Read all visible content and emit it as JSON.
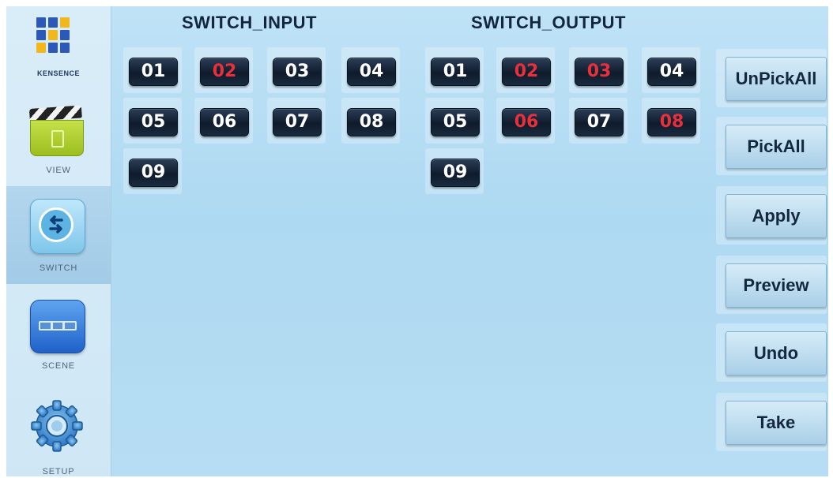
{
  "colors": {
    "selected_channel_text": "#e8303a",
    "channel_text": "#ffffff",
    "screen_background": "#aed9f2",
    "active_nav_background": "#a2cbe7"
  },
  "sidebar": {
    "logo": {
      "text": "KENSENCE",
      "icon": "kensence-logo"
    },
    "items": [
      {
        "label": "VIEW",
        "icon": "clapperboard-icon",
        "active": false
      },
      {
        "label": "SWITCH",
        "icon": "switch-arrows-icon",
        "active": true
      },
      {
        "label": "SCENE",
        "icon": "scene-icon",
        "active": false
      },
      {
        "label": "SETUP",
        "icon": "gear-icon",
        "active": false
      }
    ]
  },
  "switch_input": {
    "title": "SWITCH_INPUT",
    "channels": [
      {
        "label": "01",
        "selected": false
      },
      {
        "label": "02",
        "selected": true
      },
      {
        "label": "03",
        "selected": false
      },
      {
        "label": "04",
        "selected": false
      },
      {
        "label": "05",
        "selected": false
      },
      {
        "label": "06",
        "selected": false
      },
      {
        "label": "07",
        "selected": false
      },
      {
        "label": "08",
        "selected": false
      },
      {
        "label": "09",
        "selected": false
      }
    ]
  },
  "switch_output": {
    "title": "SWITCH_OUTPUT",
    "channels": [
      {
        "label": "01",
        "selected": false
      },
      {
        "label": "02",
        "selected": true
      },
      {
        "label": "03",
        "selected": true
      },
      {
        "label": "04",
        "selected": false
      },
      {
        "label": "05",
        "selected": false
      },
      {
        "label": "06",
        "selected": true
      },
      {
        "label": "07",
        "selected": false
      },
      {
        "label": "08",
        "selected": true
      },
      {
        "label": "09",
        "selected": false
      }
    ]
  },
  "actions": {
    "unpick_all": "UnPickAll",
    "pick_all": "PickAll",
    "apply": "Apply",
    "preview": "Preview",
    "undo": "Undo",
    "take": "Take"
  }
}
